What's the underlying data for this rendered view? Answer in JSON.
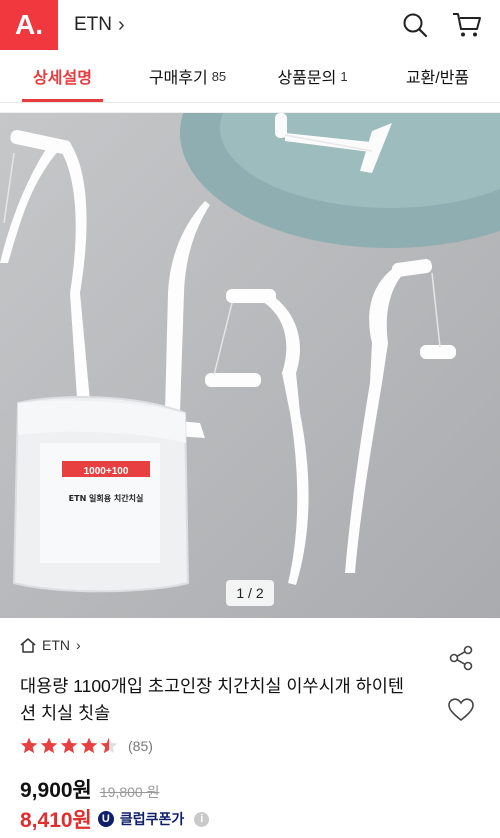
{
  "header": {
    "logo": "A.",
    "brand": "ETN",
    "chevron": "›",
    "icons": [
      "search-icon",
      "cart-icon"
    ]
  },
  "tabs": [
    {
      "label": "상세설명",
      "count": ""
    },
    {
      "label": "구매후기",
      "count": "85"
    },
    {
      "label": "상품문의",
      "count": "1"
    },
    {
      "label": "교환/반품",
      "count": ""
    }
  ],
  "colors": {
    "accent": "#e73b3f",
    "logo_bg": "#f0383e",
    "sale": "#e22d2d",
    "coupon": "#0f1e6a"
  },
  "gallery": {
    "pager": "1 / 2",
    "package_badge": "1000+100",
    "package_label": "ETN 일회용 치간치실"
  },
  "product": {
    "brand": "ETN",
    "brand_chevron": "›",
    "title": "대용량 1100개입 초고인장 치간치실 이쑤시개 하이텐션 치실 칫솔",
    "rating": 4.5,
    "rating_count": "(85)",
    "price": "9,900원",
    "original_price": "19,800 원",
    "sale_price": "8,410원",
    "coupon_badge": "U",
    "coupon_label": "클럽쿠폰가",
    "info": "i"
  }
}
